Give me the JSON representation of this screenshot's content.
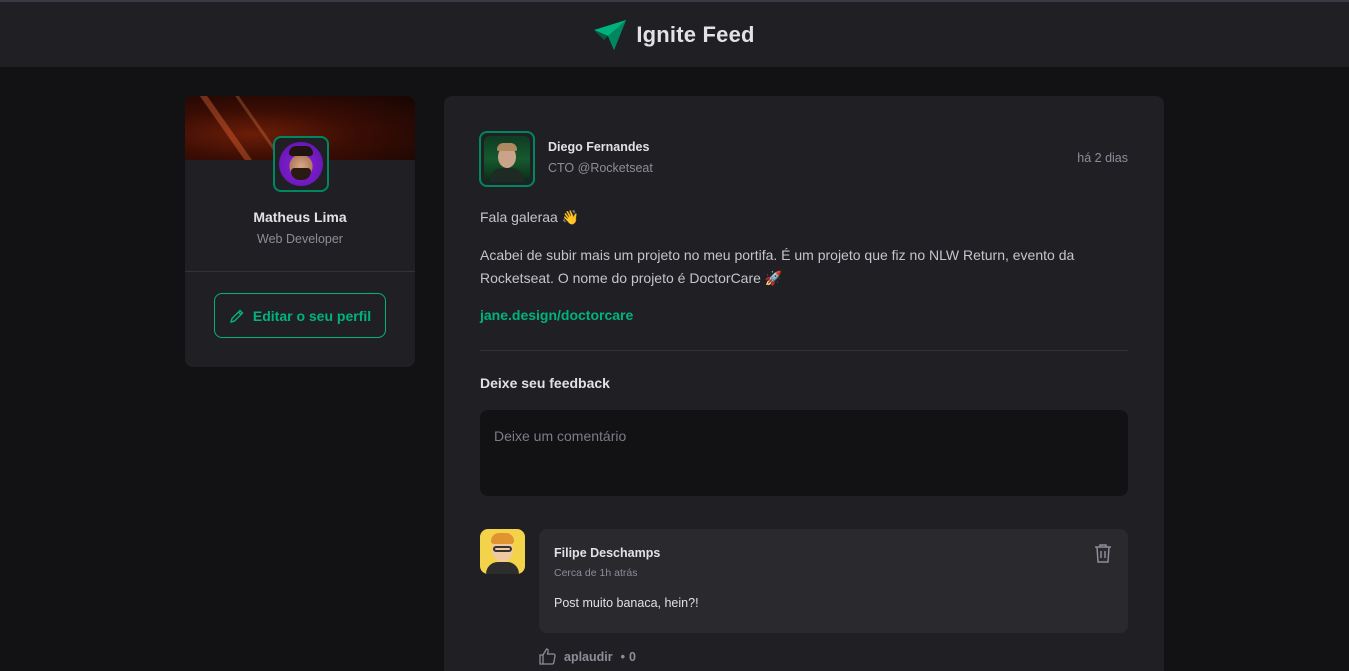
{
  "header": {
    "brand": "Ignite Feed"
  },
  "profile": {
    "name": "Matheus Lima",
    "role": "Web Developer",
    "edit_label": "Editar o seu perfil"
  },
  "post": {
    "author": {
      "name": "Diego Fernandes",
      "role": "CTO @Rocketseat"
    },
    "time": "há 2 dias",
    "content": [
      "Fala galeraa 👋",
      "Acabei de subir mais um projeto no meu portifa. É um projeto que fiz no NLW Return, evento da Rocketseat. O nome do projeto é DoctorCare 🚀"
    ],
    "link": "jane.design/doctorcare",
    "feedback_title": "Deixe seu feedback",
    "comment_placeholder": "Deixe um comentário"
  },
  "comments": [
    {
      "author": "Filipe Deschamps",
      "time": "Cerca de 1h atrás",
      "text": "Post muito banaca, hein?!",
      "applaud_label": "aplaudir",
      "applaud_separator": "•",
      "applaud_count": "0"
    }
  ],
  "colors": {
    "accent": "#00b37e",
    "avatar_border": "#00875f",
    "background": "#121214",
    "surface": "#202024"
  },
  "icons": {
    "logo": "paper-plane-logo-icon",
    "edit": "pencil-icon",
    "delete": "trash-icon",
    "applaud": "thumbs-up-icon"
  }
}
